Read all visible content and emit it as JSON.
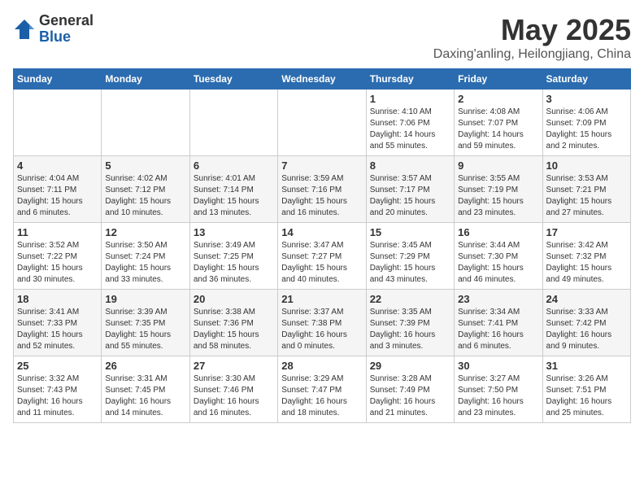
{
  "header": {
    "logo_general": "General",
    "logo_blue": "Blue",
    "month": "May 2025",
    "location": "Daxing'anling, Heilongjiang, China"
  },
  "weekdays": [
    "Sunday",
    "Monday",
    "Tuesday",
    "Wednesday",
    "Thursday",
    "Friday",
    "Saturday"
  ],
  "weeks": [
    [
      {
        "day": "",
        "info": ""
      },
      {
        "day": "",
        "info": ""
      },
      {
        "day": "",
        "info": ""
      },
      {
        "day": "",
        "info": ""
      },
      {
        "day": "1",
        "info": "Sunrise: 4:10 AM\nSunset: 7:06 PM\nDaylight: 14 hours\nand 55 minutes."
      },
      {
        "day": "2",
        "info": "Sunrise: 4:08 AM\nSunset: 7:07 PM\nDaylight: 14 hours\nand 59 minutes."
      },
      {
        "day": "3",
        "info": "Sunrise: 4:06 AM\nSunset: 7:09 PM\nDaylight: 15 hours\nand 2 minutes."
      }
    ],
    [
      {
        "day": "4",
        "info": "Sunrise: 4:04 AM\nSunset: 7:11 PM\nDaylight: 15 hours\nand 6 minutes."
      },
      {
        "day": "5",
        "info": "Sunrise: 4:02 AM\nSunset: 7:12 PM\nDaylight: 15 hours\nand 10 minutes."
      },
      {
        "day": "6",
        "info": "Sunrise: 4:01 AM\nSunset: 7:14 PM\nDaylight: 15 hours\nand 13 minutes."
      },
      {
        "day": "7",
        "info": "Sunrise: 3:59 AM\nSunset: 7:16 PM\nDaylight: 15 hours\nand 16 minutes."
      },
      {
        "day": "8",
        "info": "Sunrise: 3:57 AM\nSunset: 7:17 PM\nDaylight: 15 hours\nand 20 minutes."
      },
      {
        "day": "9",
        "info": "Sunrise: 3:55 AM\nSunset: 7:19 PM\nDaylight: 15 hours\nand 23 minutes."
      },
      {
        "day": "10",
        "info": "Sunrise: 3:53 AM\nSunset: 7:21 PM\nDaylight: 15 hours\nand 27 minutes."
      }
    ],
    [
      {
        "day": "11",
        "info": "Sunrise: 3:52 AM\nSunset: 7:22 PM\nDaylight: 15 hours\nand 30 minutes."
      },
      {
        "day": "12",
        "info": "Sunrise: 3:50 AM\nSunset: 7:24 PM\nDaylight: 15 hours\nand 33 minutes."
      },
      {
        "day": "13",
        "info": "Sunrise: 3:49 AM\nSunset: 7:25 PM\nDaylight: 15 hours\nand 36 minutes."
      },
      {
        "day": "14",
        "info": "Sunrise: 3:47 AM\nSunset: 7:27 PM\nDaylight: 15 hours\nand 40 minutes."
      },
      {
        "day": "15",
        "info": "Sunrise: 3:45 AM\nSunset: 7:29 PM\nDaylight: 15 hours\nand 43 minutes."
      },
      {
        "day": "16",
        "info": "Sunrise: 3:44 AM\nSunset: 7:30 PM\nDaylight: 15 hours\nand 46 minutes."
      },
      {
        "day": "17",
        "info": "Sunrise: 3:42 AM\nSunset: 7:32 PM\nDaylight: 15 hours\nand 49 minutes."
      }
    ],
    [
      {
        "day": "18",
        "info": "Sunrise: 3:41 AM\nSunset: 7:33 PM\nDaylight: 15 hours\nand 52 minutes."
      },
      {
        "day": "19",
        "info": "Sunrise: 3:39 AM\nSunset: 7:35 PM\nDaylight: 15 hours\nand 55 minutes."
      },
      {
        "day": "20",
        "info": "Sunrise: 3:38 AM\nSunset: 7:36 PM\nDaylight: 15 hours\nand 58 minutes."
      },
      {
        "day": "21",
        "info": "Sunrise: 3:37 AM\nSunset: 7:38 PM\nDaylight: 16 hours\nand 0 minutes."
      },
      {
        "day": "22",
        "info": "Sunrise: 3:35 AM\nSunset: 7:39 PM\nDaylight: 16 hours\nand 3 minutes."
      },
      {
        "day": "23",
        "info": "Sunrise: 3:34 AM\nSunset: 7:41 PM\nDaylight: 16 hours\nand 6 minutes."
      },
      {
        "day": "24",
        "info": "Sunrise: 3:33 AM\nSunset: 7:42 PM\nDaylight: 16 hours\nand 9 minutes."
      }
    ],
    [
      {
        "day": "25",
        "info": "Sunrise: 3:32 AM\nSunset: 7:43 PM\nDaylight: 16 hours\nand 11 minutes."
      },
      {
        "day": "26",
        "info": "Sunrise: 3:31 AM\nSunset: 7:45 PM\nDaylight: 16 hours\nand 14 minutes."
      },
      {
        "day": "27",
        "info": "Sunrise: 3:30 AM\nSunset: 7:46 PM\nDaylight: 16 hours\nand 16 minutes."
      },
      {
        "day": "28",
        "info": "Sunrise: 3:29 AM\nSunset: 7:47 PM\nDaylight: 16 hours\nand 18 minutes."
      },
      {
        "day": "29",
        "info": "Sunrise: 3:28 AM\nSunset: 7:49 PM\nDaylight: 16 hours\nand 21 minutes."
      },
      {
        "day": "30",
        "info": "Sunrise: 3:27 AM\nSunset: 7:50 PM\nDaylight: 16 hours\nand 23 minutes."
      },
      {
        "day": "31",
        "info": "Sunrise: 3:26 AM\nSunset: 7:51 PM\nDaylight: 16 hours\nand 25 minutes."
      }
    ]
  ]
}
